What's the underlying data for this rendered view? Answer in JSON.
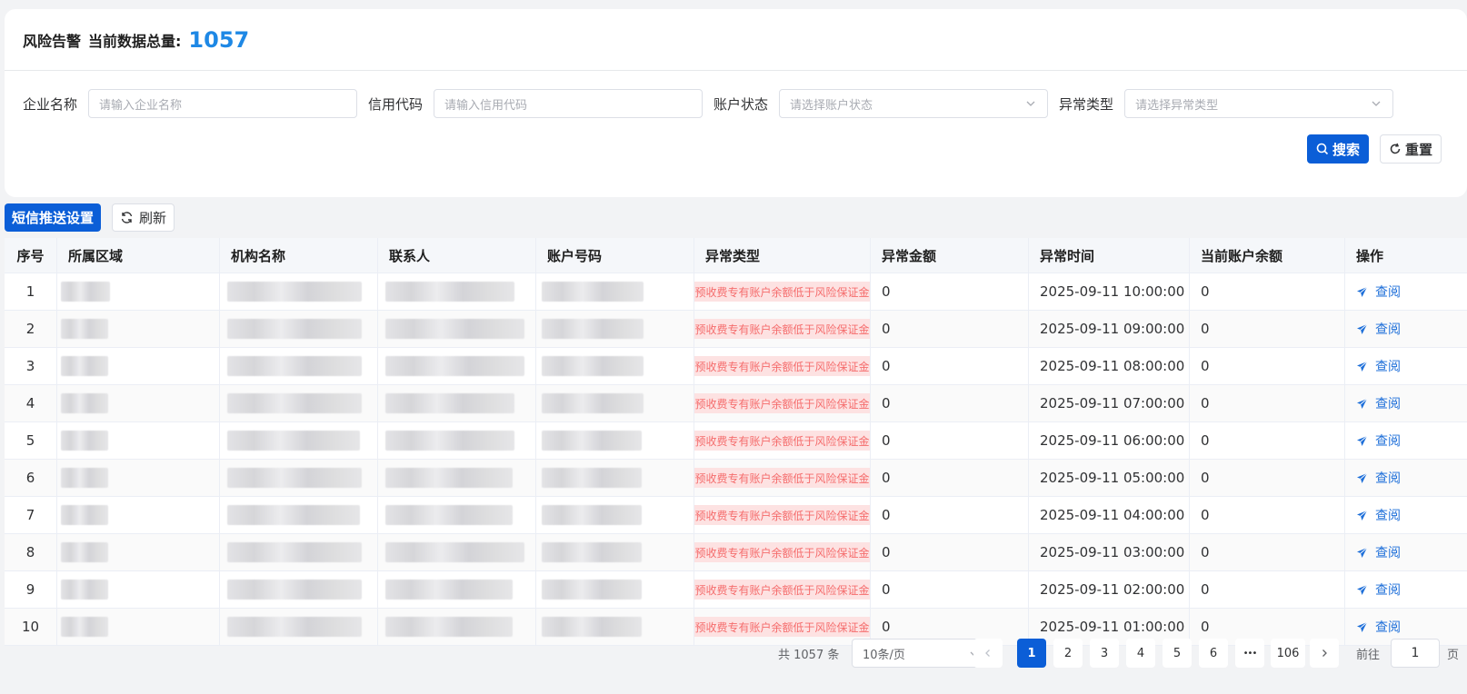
{
  "header": {
    "title": "风险告警",
    "total_label": "当前数据总量:",
    "total_count": "1057"
  },
  "filters": [
    {
      "label": "企业名称",
      "placeholder": "请输入企业名称",
      "type": "input"
    },
    {
      "label": "信用代码",
      "placeholder": "请输入信用代码",
      "type": "input"
    },
    {
      "label": "账户状态",
      "placeholder": "请选择账户状态",
      "type": "select"
    },
    {
      "label": "异常类型",
      "placeholder": "请选择异常类型",
      "type": "select"
    }
  ],
  "buttons": {
    "search": "搜索",
    "reset": "重置",
    "sms_settings": "短信推送设置",
    "refresh": "刷新"
  },
  "table": {
    "headers": [
      "序号",
      "所属区域",
      "机构名称",
      "联系人",
      "账户号码",
      "异常类型",
      "异常金额",
      "异常时间",
      "当前账户余额",
      "操作"
    ],
    "rows": [
      {
        "index": "1",
        "type": "预收费专有账户余额低于风险保证金",
        "amount": "0",
        "time": "2025-09-11 10:00:00",
        "balance": "0",
        "action": "查阅"
      },
      {
        "index": "2",
        "type": "预收费专有账户余额低于风险保证金",
        "amount": "0",
        "time": "2025-09-11 09:00:00",
        "balance": "0",
        "action": "查阅"
      },
      {
        "index": "3",
        "type": "预收费专有账户余额低于风险保证金",
        "amount": "0",
        "time": "2025-09-11 08:00:00",
        "balance": "0",
        "action": "查阅"
      },
      {
        "index": "4",
        "type": "预收费专有账户余额低于风险保证金",
        "amount": "0",
        "time": "2025-09-11 07:00:00",
        "balance": "0",
        "action": "查阅"
      },
      {
        "index": "5",
        "type": "预收费专有账户余额低于风险保证金",
        "amount": "0",
        "time": "2025-09-11 06:00:00",
        "balance": "0",
        "action": "查阅"
      },
      {
        "index": "6",
        "type": "预收费专有账户余额低于风险保证金",
        "amount": "0",
        "time": "2025-09-11 05:00:00",
        "balance": "0",
        "action": "查阅"
      },
      {
        "index": "7",
        "type": "预收费专有账户余额低于风险保证金",
        "amount": "0",
        "time": "2025-09-11 04:00:00",
        "balance": "0",
        "action": "查阅"
      },
      {
        "index": "8",
        "type": "预收费专有账户余额低于风险保证金",
        "amount": "0",
        "time": "2025-09-11 03:00:00",
        "balance": "0",
        "action": "查阅"
      },
      {
        "index": "9",
        "type": "预收费专有账户余额低于风险保证金",
        "amount": "0",
        "time": "2025-09-11 02:00:00",
        "balance": "0",
        "action": "查阅"
      },
      {
        "index": "10",
        "type": "预收费专有账户余额低于风险保证金",
        "amount": "0",
        "time": "2025-09-11 01:00:00",
        "balance": "0",
        "action": "查阅"
      }
    ]
  },
  "pagination": {
    "total_text": "共 1057 条",
    "page_size": "10条/页",
    "pages": [
      "1",
      "2",
      "3",
      "4",
      "5",
      "6"
    ],
    "ellipsis": "•••",
    "last_page": "106",
    "current": "1",
    "goto_label": "前往",
    "goto_value": "1",
    "page_suffix": "页"
  },
  "colors": {
    "primary": "#0b5ed7",
    "count": "#1e88e5",
    "tag_bg": "#fde2e2",
    "tag_text": "#f56c6c",
    "link": "#1e6fd9"
  }
}
